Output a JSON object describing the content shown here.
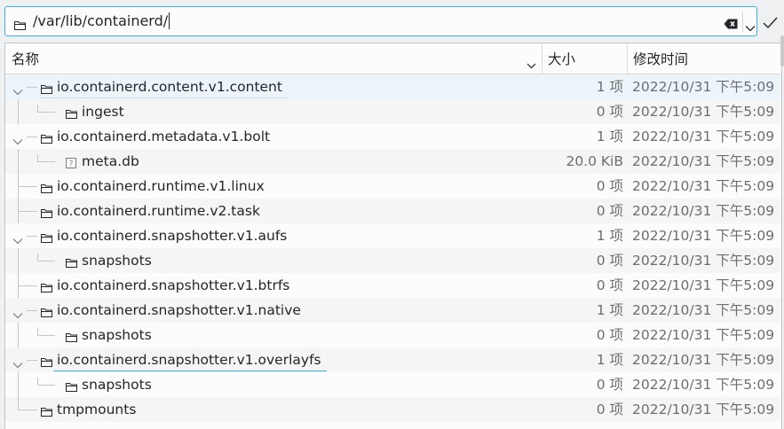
{
  "location": {
    "path": "/var/lib/containerd/"
  },
  "columns": {
    "name": "名称",
    "size": "大小",
    "modified": "修改时间"
  },
  "rows": [
    {
      "name": "io.containerd.content.v1.content",
      "size": "1 项",
      "date": "2022/10/31 下午5:09",
      "icon": "folder-icon",
      "expanded": true
    },
    {
      "name": "ingest",
      "size": "0 项",
      "date": "2022/10/31 下午5:09",
      "icon": "folder-icon",
      "child": true
    },
    {
      "name": "io.containerd.metadata.v1.bolt",
      "size": "1 项",
      "date": "2022/10/31 下午5:09",
      "icon": "folder-icon",
      "expanded": true
    },
    {
      "name": "meta.db",
      "size": "20.0 KiB",
      "date": "2022/10/31 下午5:09",
      "icon": "unknown-file-icon",
      "child": true
    },
    {
      "name": "io.containerd.runtime.v1.linux",
      "size": "0 项",
      "date": "2022/10/31 下午5:09",
      "icon": "folder-icon"
    },
    {
      "name": "io.containerd.runtime.v2.task",
      "size": "0 项",
      "date": "2022/10/31 下午5:09",
      "icon": "folder-icon"
    },
    {
      "name": "io.containerd.snapshotter.v1.aufs",
      "size": "1 项",
      "date": "2022/10/31 下午5:09",
      "icon": "folder-icon",
      "expanded": true
    },
    {
      "name": "snapshots",
      "size": "0 项",
      "date": "2022/10/31 下午5:09",
      "icon": "folder-icon",
      "child": true
    },
    {
      "name": "io.containerd.snapshotter.v1.btrfs",
      "size": "0 项",
      "date": "2022/10/31 下午5:09",
      "icon": "folder-icon"
    },
    {
      "name": "io.containerd.snapshotter.v1.native",
      "size": "1 项",
      "date": "2022/10/31 下午5:09",
      "icon": "folder-icon",
      "expanded": true
    },
    {
      "name": "snapshots",
      "size": "0 项",
      "date": "2022/10/31 下午5:09",
      "icon": "folder-icon",
      "child": true
    },
    {
      "name": "io.containerd.snapshotter.v1.overlayfs",
      "size": "1 项",
      "date": "2022/10/31 下午5:09",
      "icon": "folder-icon",
      "expanded": true
    },
    {
      "name": "snapshots",
      "size": "0 项",
      "date": "2022/10/31 下午5:09",
      "icon": "folder-icon",
      "child": true
    },
    {
      "name": "tmpmounts",
      "size": "0 项",
      "date": "2022/10/31 下午5:09",
      "icon": "folder-icon"
    }
  ],
  "colors": {
    "accent": "#3daee9",
    "text": "#232629",
    "muted": "#6b6e71"
  }
}
